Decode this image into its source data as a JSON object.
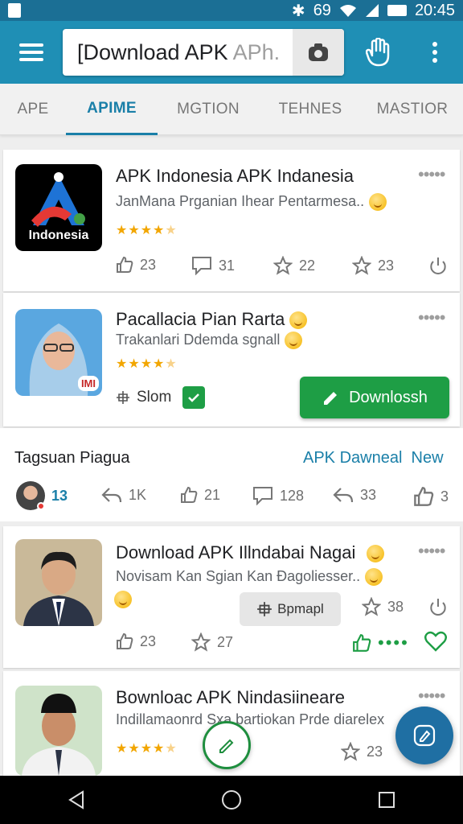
{
  "status_bar": {
    "signal_text": "69",
    "time": "20:45"
  },
  "search": {
    "value": "[Download APK ",
    "placeholder": "APh."
  },
  "tabs": [
    {
      "label": "APE"
    },
    {
      "label": "APIME",
      "active": true
    },
    {
      "label": "MGTION"
    },
    {
      "label": "TEHNES"
    },
    {
      "label": "MASTIOR"
    }
  ],
  "cards": [
    {
      "title": "APK Indonesia APK Indanesia",
      "subtitle": "JanMana Prganian Ihear Pentarmesa..",
      "logo_text": "Indonesia",
      "stats": [
        "23",
        "31",
        "22",
        "23"
      ]
    },
    {
      "title": "Pacallacia Pian Rarta",
      "subtitle": "Trakanlari Ddemda sgnall",
      "badge": "IMI",
      "option_label": "Slom",
      "download_label": "Downlossh"
    }
  ],
  "section": {
    "title": "Tagsuan Piagua",
    "link_label": "APK Dawneal",
    "link_new": "New",
    "stats": [
      "13",
      "1K",
      "21",
      "128",
      "33",
      "3"
    ]
  },
  "card3": {
    "title": "Download APK Illndabai Nagai",
    "subtitle": "Novisam Kan Sgian Kan Đagoliesser..",
    "chip_label": "Bpmapl",
    "stats": [
      "38",
      "23",
      "27"
    ]
  },
  "card4": {
    "title": "Bownloac APK Nindasiineare",
    "subtitle": "Indillamaonrd Sxa bartiokan Prde diarelex",
    "stat": "23"
  },
  "colors": {
    "appbar": "#1f8fb5",
    "accent": "#1a7fa8",
    "download_green": "#1e9e45",
    "star": "#f2a600"
  },
  "icons": [
    "menu-icon",
    "camera-icon",
    "hand-icon",
    "more-vert-icon",
    "thumb-up-icon",
    "comment-icon",
    "star-icon",
    "power-icon",
    "share-icon",
    "heart-icon",
    "edit-icon",
    "back-icon",
    "home-icon",
    "recents-icon"
  ]
}
